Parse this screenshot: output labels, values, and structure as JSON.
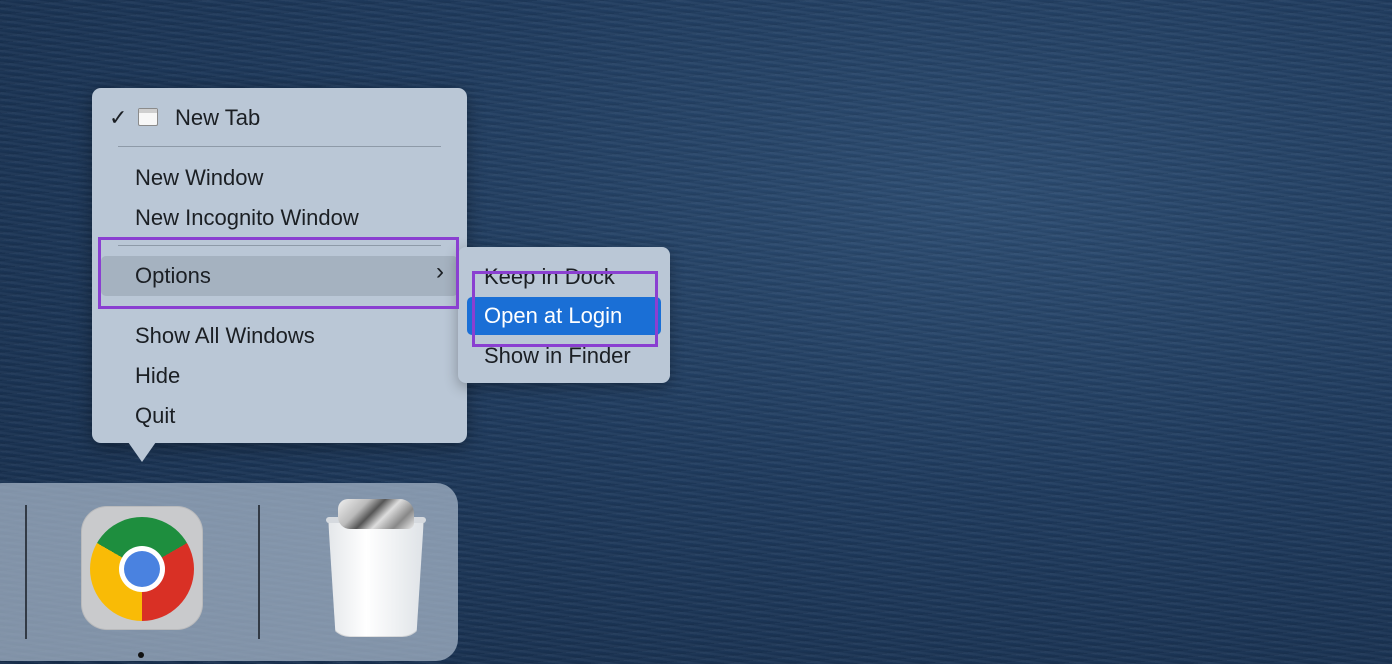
{
  "context_menu": {
    "items": [
      {
        "label": "New Tab",
        "checked": true,
        "icon": "window-icon"
      },
      {
        "label": "New Window"
      },
      {
        "label": "New Incognito Window"
      },
      {
        "label": "Options",
        "has_submenu": true,
        "icon": "chevron-right-icon"
      },
      {
        "label": "Show All Windows"
      },
      {
        "label": "Hide"
      },
      {
        "label": "Quit"
      }
    ],
    "checkmark": "✓",
    "chevron": "›"
  },
  "submenu": {
    "items": [
      {
        "label": "Keep in Dock"
      },
      {
        "label": "Open at Login",
        "highlighted": true
      },
      {
        "label": "Show in Finder"
      }
    ]
  },
  "dock": {
    "apps": [
      {
        "name": "chrome-icon",
        "running": true
      },
      {
        "name": "trash-icon",
        "running": false
      }
    ]
  },
  "colors": {
    "menu_bg": "#bac7d6",
    "highlight": "#1a6fd6",
    "annotation": "#8a3fd1",
    "desktop": "#1f3b5e"
  }
}
